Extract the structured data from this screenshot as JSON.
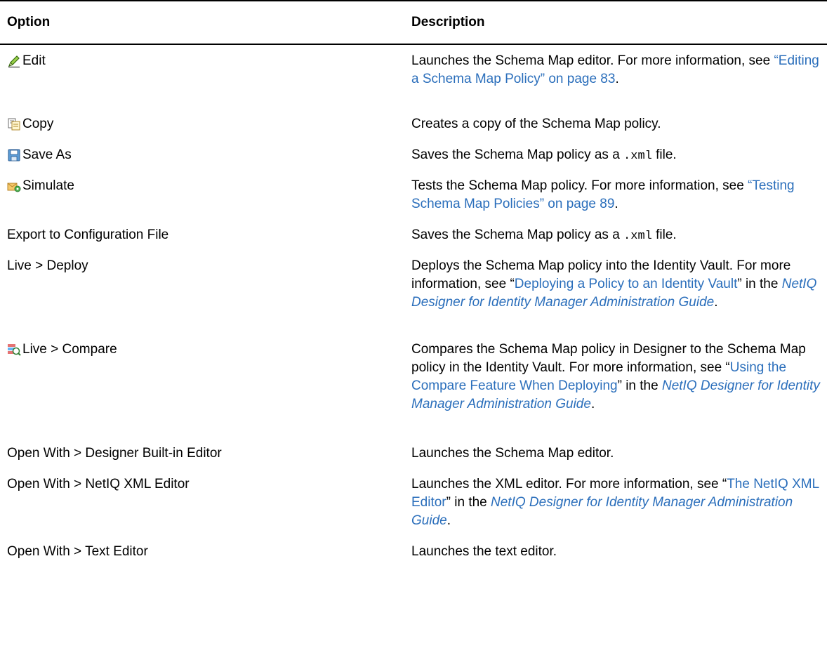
{
  "table": {
    "headers": {
      "option": "Option",
      "description": "Description"
    },
    "rows": [
      {
        "option": "Edit",
        "icon": "pencil-icon",
        "desc": {
          "t1": "Launches the Schema Map editor. For more information, see ",
          "link": "“Editing a Schema Map Policy” on page 83",
          "t2": "."
        }
      },
      {
        "option": "Copy",
        "icon": "copy-icon",
        "desc": {
          "t1": "Creates a copy of the Schema Map policy."
        }
      },
      {
        "option": "Save As",
        "icon": "save-icon",
        "desc": {
          "t1": "Saves the Schema Map policy as a ",
          "code": ".xml",
          "t2": " file."
        }
      },
      {
        "option": "Simulate",
        "icon": "simulate-icon",
        "desc": {
          "t1": "Tests the Schema Map policy. For more information, see ",
          "link": "“Testing Schema Map Policies” on page 89",
          "t2": "."
        }
      },
      {
        "option": "Export to Configuration File",
        "desc": {
          "t1": "Saves the Schema Map policy as a ",
          "code": ".xml",
          "t2": " file."
        }
      },
      {
        "option": "Live > Deploy",
        "desc": {
          "t1": "Deploys the Schema Map policy into the Identity Vault. For more information, see “",
          "link": "Deploying a Policy to an Identity Vault",
          "t2": "” in the ",
          "guide": "NetIQ Designer for Identity Manager Administration Guide",
          "t3": "."
        }
      },
      {
        "option": "Live > Compare",
        "icon": "compare-icon",
        "desc": {
          "t1": "Compares the Schema Map policy in Designer to the Schema Map policy in the Identity Vault. For more information, see “",
          "link": "Using the Compare Feature When Deploying",
          "t2": "” in the ",
          "guide": "NetIQ Designer for Identity Manager Administration Guide",
          "t3": "."
        }
      },
      {
        "option": "Open With > Designer Built-in Editor",
        "desc": {
          "t1": "Launches the Schema Map editor."
        }
      },
      {
        "option": "Open With > NetIQ XML Editor",
        "desc": {
          "t1": "Launches the XML editor. For more information, see “",
          "link": "The NetIQ XML Editor",
          "t2": "” in the ",
          "guide": "NetIQ Designer for Identity Manager Administration Guide",
          "t3": "."
        }
      },
      {
        "option": "Open With > Text Editor",
        "desc": {
          "t1": "Launches the text editor."
        }
      }
    ]
  }
}
